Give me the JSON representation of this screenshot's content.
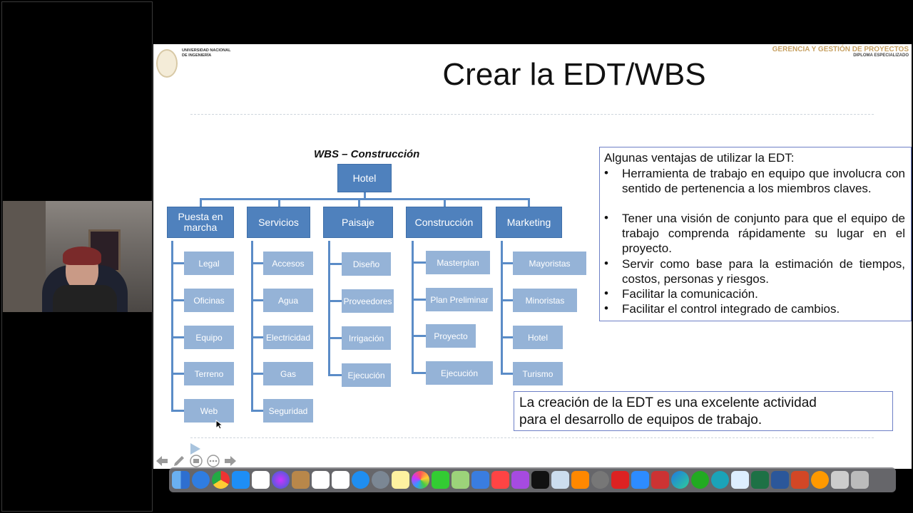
{
  "slide": {
    "university_line1": "UNIVERSIDAD NACIONAL",
    "university_line2": "DE INGENIERÍA",
    "brand_line1": "GERENCIA Y GESTIÓN DE PROYECTOS",
    "brand_line2": "DIPLOMA ESPECIALIZADO",
    "title": "Crear la EDT/WBS",
    "wbs_title": "WBS – Construcción",
    "root": "Hotel",
    "branches": [
      {
        "label_line1": "Puesta en",
        "label_line2": "marcha",
        "items": [
          "Legal",
          "Oficinas",
          "Equipo",
          "Terreno",
          "Web"
        ]
      },
      {
        "label_line1": "Servicios",
        "label_line2": "",
        "items": [
          "Accesos",
          "Agua",
          "Electricidad",
          "Gas",
          "Seguridad"
        ]
      },
      {
        "label_line1": "Paisaje",
        "label_line2": "",
        "items": [
          "Diseño",
          "Proveedores",
          "Irrigación",
          "Ejecución"
        ]
      },
      {
        "label_line1": "Construcción",
        "label_line2": "",
        "items": [
          "Masterplan",
          "Plan Preliminar",
          "Proyecto",
          "Ejecución"
        ]
      },
      {
        "label_line1": "Marketing",
        "label_line2": "",
        "items": [
          "Mayoristas",
          "Minoristas",
          "Hotel",
          "Turismo"
        ]
      }
    ],
    "advantages": {
      "title": "Algunas ventajas de utilizar la EDT:",
      "bullets": [
        "Herramienta de trabajo en equipo que involucra con sentido de pertenencia a los miembros claves.",
        "Tener una visión de conjunto para que el equipo de trabajo comprenda rápidamente su lugar en el proyecto.",
        "Servir como base para la estimación de tiempos, costos, personas y riesgos.",
        "Facilitar la comunicación.",
        "Facilitar el control integrado de cambios."
      ]
    },
    "conclusion_line1": "La creación de la EDT es una excelente actividad",
    "conclusion_line2": "para el desarrollo de equipos de trabajo."
  },
  "colors": {
    "node_top": "#4f81bd",
    "node_sub": "#95b3d7",
    "box_border": "#6d7fc6",
    "brand": "#c8a264"
  },
  "presentation_controls": [
    "arrow-left-icon",
    "pen-icon",
    "slides-icon",
    "more-icon",
    "arrow-right-icon"
  ],
  "dock_icons": [
    "finder",
    "safari",
    "chrome",
    "app-store",
    "numbers",
    "siri",
    "notes-folder",
    "calendar",
    "reminders",
    "messages",
    "launchpad",
    "stickies",
    "photos",
    "facetime",
    "maps",
    "keynote",
    "music",
    "podcasts",
    "tv",
    "preview",
    "books",
    "system-preferences",
    "acrobat",
    "zoom",
    "photo-booth",
    "edge",
    "quicktime",
    "remote",
    "screen-capture",
    "excel",
    "word",
    "powerpoint",
    "settings-flower",
    "scanner",
    "trash"
  ]
}
